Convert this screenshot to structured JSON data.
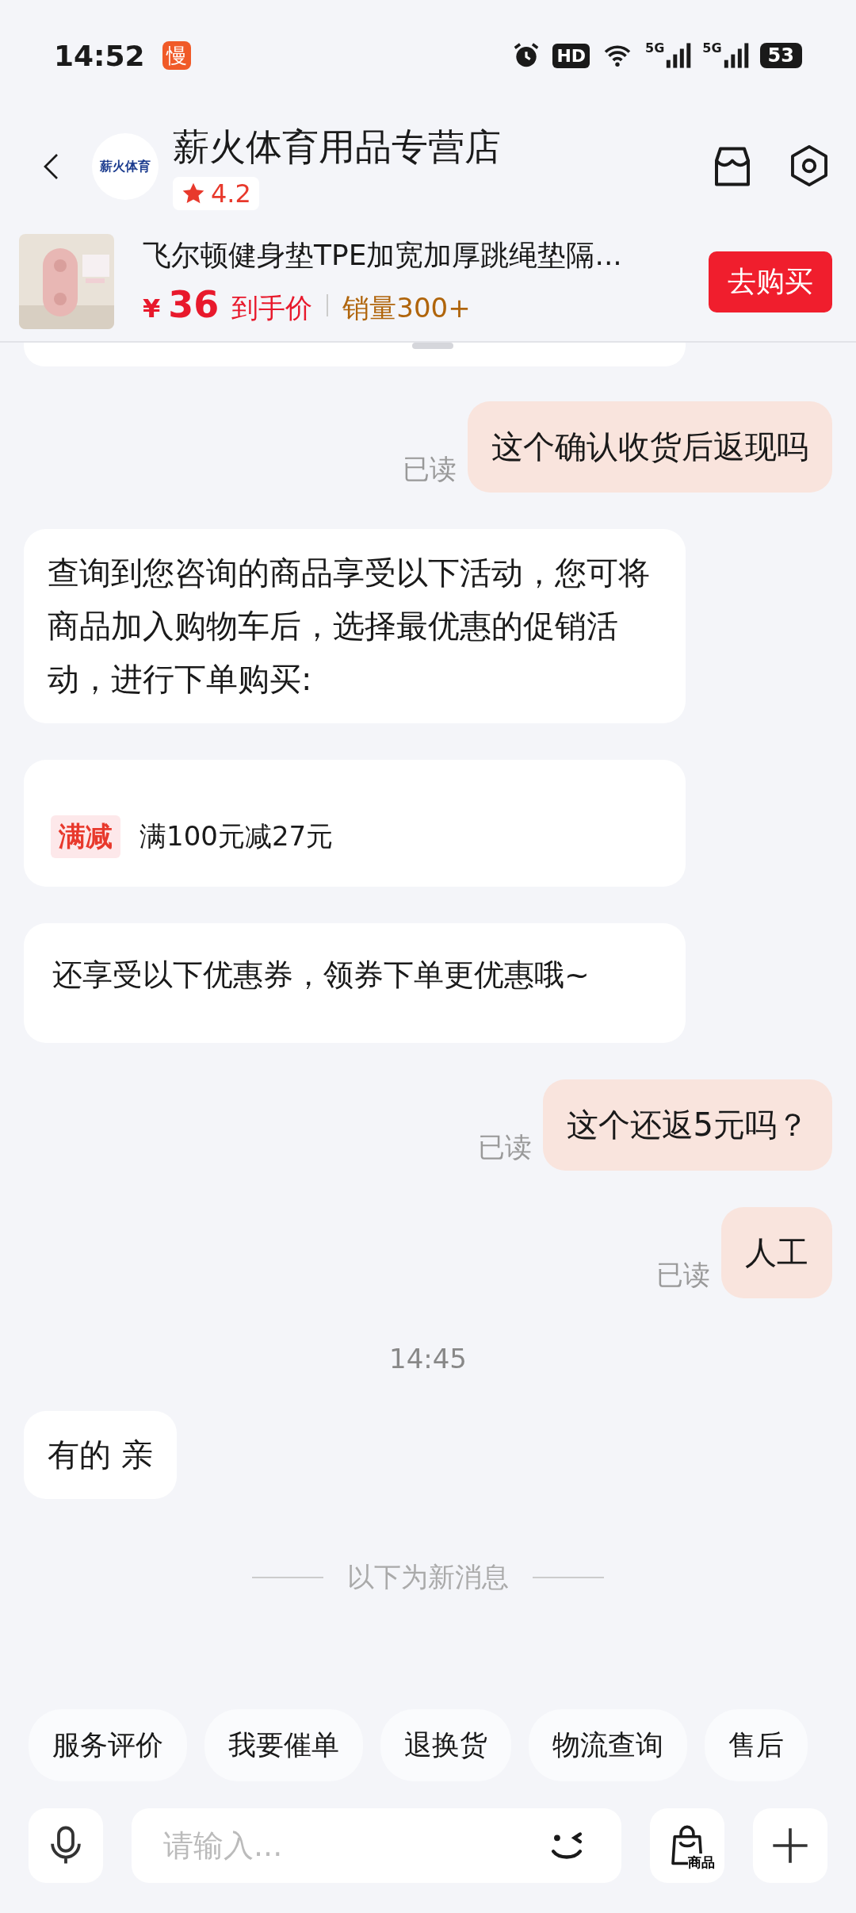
{
  "status_bar": {
    "time": "14:52",
    "app_badge": "慢",
    "hd": "HD",
    "sims": [
      {
        "label": "5G"
      },
      {
        "label": "5G"
      }
    ],
    "battery": "53"
  },
  "header": {
    "logo_text": "薪火体育",
    "shop_name": "薪火体育用品专营店",
    "rating": "4.2"
  },
  "product": {
    "title": "飞尔顿健身垫TPE加宽加厚跳绳垫隔...",
    "currency": "¥",
    "price": "36",
    "price_label": "到手价",
    "sales": "销量300+",
    "buy_button": "去购买"
  },
  "messages": [
    {
      "kind": "cut"
    },
    {
      "kind": "outgoing",
      "text": "这个确认收货后返现吗",
      "receipt": "已读"
    },
    {
      "kind": "incoming",
      "text": "查询到您咨询的商品享受以下活动，您可将商品加入购物车后，选择最优惠的促销活动，进行下单购买:"
    },
    {
      "kind": "promo",
      "tag": "满减",
      "text": "满100元减27元"
    },
    {
      "kind": "notice",
      "text": "还享受以下优惠券，领券下单更优惠哦~"
    },
    {
      "kind": "outgoing",
      "text": "这个还返5元吗？",
      "receipt": "已读"
    },
    {
      "kind": "outgoing",
      "text": "人工",
      "receipt": "已读"
    },
    {
      "kind": "time",
      "text": "14:45"
    },
    {
      "kind": "incoming",
      "text": "有的 亲"
    },
    {
      "kind": "divider",
      "text": "以下为新消息"
    }
  ],
  "quick_replies": [
    "服务评价",
    "我要催单",
    "退换货",
    "物流查询",
    "售后"
  ],
  "input": {
    "placeholder": "请输入...",
    "goods_label": "商品"
  }
}
